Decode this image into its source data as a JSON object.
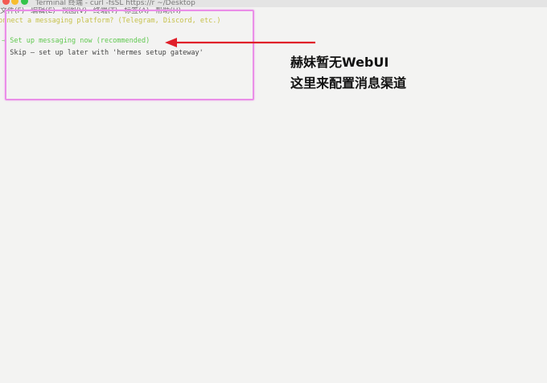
{
  "window": {
    "title": "Terminal 终端 - curl -fsSL https://r ~/Desktop",
    "colors": {
      "close": "#f35a52",
      "minimize": "#f6bd2e",
      "zoom": "#34c449"
    }
  },
  "menu": [
    "文件(F)",
    "编辑(E)",
    "视图(V)",
    "终端(T)",
    "标签(A)",
    "帮助(H)"
  ],
  "terminal": {
    "prompt": "Connect a messaging platform? (Telegram, Discord, etc.)",
    "options": [
      {
        "marker": "→",
        "text": "Set up messaging now (recommended)",
        "selected": true
      },
      {
        "marker": " ",
        "text": "Skip — set up later with 'hermes setup gateway'",
        "selected": false
      }
    ]
  },
  "annotation": {
    "line1": "赫妹暂无WebUI",
    "line2": "这里来配置消息渠道",
    "highlight_color": "#ea8ee8",
    "arrow_color": "#e0202a"
  }
}
